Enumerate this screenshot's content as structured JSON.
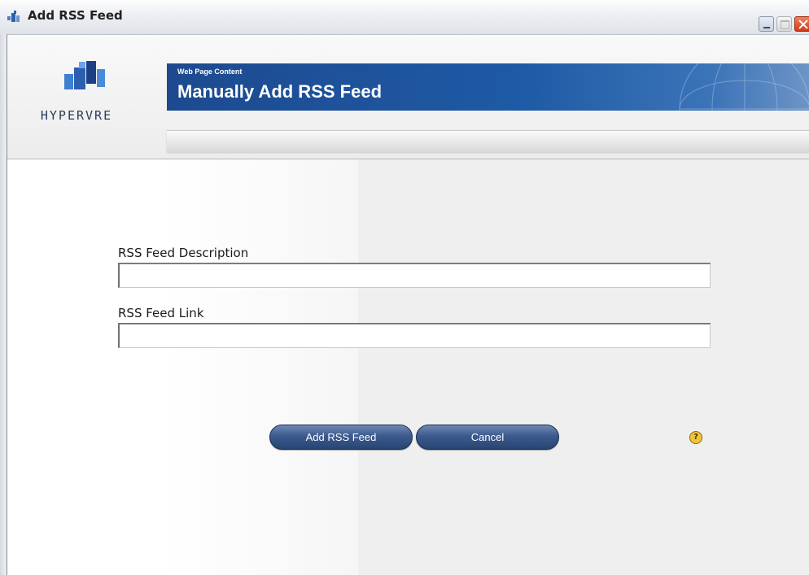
{
  "window": {
    "title": "Add RSS Feed",
    "icon": "rss-app-icon",
    "controls": [
      "minimize-button",
      "maximize-button",
      "close-button"
    ]
  },
  "header": {
    "logo_text": "HYPERVRE",
    "banner_subtitle": "Web Page Content",
    "banner_title": "Manually Add RSS Feed"
  },
  "form": {
    "description_label": "RSS Feed Description",
    "description_value": "",
    "link_label": "RSS Feed Link",
    "link_value": ""
  },
  "buttons": {
    "add_label": "Add RSS Feed",
    "cancel_label": "Cancel"
  },
  "help": {
    "icon": "help-icon",
    "glyph": "?"
  },
  "colors": {
    "banner": "#1e5aa5",
    "button": "#3c5a8e",
    "help": "#f4c430"
  }
}
